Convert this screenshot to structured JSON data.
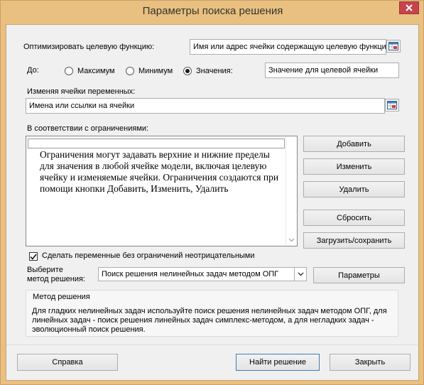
{
  "window": {
    "title": "Параметры поиска решения"
  },
  "objective": {
    "label": "Оптимизировать целевую функцию:",
    "value": "Имя или адрес ячейки содержащую целевую функцию"
  },
  "to": {
    "label": "До:",
    "options": [
      "Максимум",
      "Минимум",
      "Значения:"
    ],
    "selected": "Значения:",
    "value": "Значение для целевой ячейки"
  },
  "changing": {
    "label": "Изменяя ячейки переменных:",
    "value": "Имена или ссылки на ячейки"
  },
  "constraints": {
    "label": "В соответствии с ограничениями:",
    "hint": "Ограничения могут задавать верхние и нижние пределы для значения в любой ячейке модели, включая целевую ячейку и изменяемые ячейки. Ограничения создаются при помощи кнопки Добавить, Изменить, Удалить"
  },
  "buttons": {
    "add": "Добавить",
    "change": "Изменить",
    "delete": "Удалить",
    "reset": "Сбросить",
    "load_save": "Загрузить/сохранить",
    "parameters": "Параметры",
    "help": "Справка",
    "solve": "Найти решение",
    "close": "Закрыть"
  },
  "nonneg": {
    "label": "Сделать переменные без ограничений неотрицательными",
    "checked": true
  },
  "method": {
    "label_line1": "Выберите",
    "label_line2": "метод решения:",
    "selected": "Поиск решения нелинейных задач методом ОПГ"
  },
  "method_info": {
    "title": "Метод решения",
    "text": "Для гладких нелинейных задач используйте поиск решения нелинейных задач методом ОПГ, для линейных задач - поиск решения линейных задач симплекс-методом, а для негладких задач - эволюционный поиск решения."
  },
  "icons": {
    "close": "close-icon",
    "ref": "range-select-icon",
    "check": "checkmark-icon",
    "dropdown": "chevron-down-icon"
  }
}
